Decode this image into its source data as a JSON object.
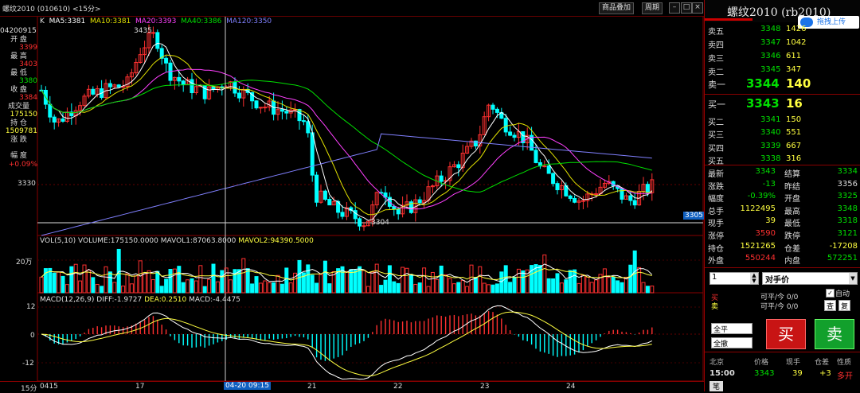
{
  "app": {
    "title": "螺纹2010 (010610) <15分>",
    "btn_add": "商品叠加",
    "btn_period": "周期"
  },
  "main_chart": {
    "indicator_label": "K",
    "ma5": "MA5:3381",
    "ma10": "MA10:3381",
    "ma20": "MA20:3393",
    "ma40": "MA40:3386",
    "ma120": "MA120:3350",
    "high_marker": "3435",
    "low_marker": "3304",
    "right_tag": "3305",
    "y_label": "3330",
    "info": {
      "date": "04200915",
      "open_label": "开 盘",
      "open": "3399",
      "high_label": "最 高",
      "high": "3403",
      "low_label": "最 低",
      "low": "3380",
      "close_label": "收 盘",
      "close": "3384",
      "vol_label": "成交量",
      "vol": "175150",
      "oi_label": "持 仓",
      "oi": "1509781",
      "chg_label": "涨 跌",
      "chg": "",
      "pct_label": "幅 度",
      "pct": "+0.09%"
    }
  },
  "vol_chart": {
    "label": "VOL(5,10)",
    "volume": "VOLUME:175150.0000",
    "mavol1": "MAVOL1:87063.8000",
    "mavol2": "MAVOL2:94390.5000",
    "y_label": "20万"
  },
  "macd_chart": {
    "label": "MACD(12,26,9)",
    "diff": "DIFF:-1.9727",
    "dea": "DEA:0.2510",
    "macd": "MACD:-4.4475",
    "y_top": "12",
    "y_mid": "0",
    "y_bot": "-12"
  },
  "xaxis": {
    "period": "15分",
    "labels": [
      "0415",
      "17",
      "21",
      "22",
      "23",
      "24"
    ],
    "cursor": "04-20 09:15"
  },
  "panel": {
    "title": "螺纹2010 (rb2010)",
    "cloud": "拖拽上传",
    "asks": [
      {
        "label": "卖五",
        "price": "3348",
        "vol": "1426"
      },
      {
        "label": "卖四",
        "price": "3347",
        "vol": "1042"
      },
      {
        "label": "卖三",
        "price": "3346",
        "vol": "611"
      },
      {
        "label": "卖二",
        "price": "3345",
        "vol": "347"
      },
      {
        "label": "卖一",
        "price": "3344",
        "vol": "140"
      }
    ],
    "bids": [
      {
        "label": "买一",
        "price": "3343",
        "vol": "16"
      },
      {
        "label": "买二",
        "price": "3341",
        "vol": "150"
      },
      {
        "label": "买三",
        "price": "3340",
        "vol": "551"
      },
      {
        "label": "买四",
        "price": "3339",
        "vol": "667"
      },
      {
        "label": "买五",
        "price": "3338",
        "vol": "316"
      }
    ],
    "stats": [
      {
        "l1": "最新",
        "v1": "3343",
        "c1": "g",
        "l2": "结算",
        "v2": "3334",
        "c2": "g"
      },
      {
        "l1": "涨跌",
        "v1": "-13",
        "c1": "g",
        "l2": "昨结",
        "v2": "3356",
        "c2": "w"
      },
      {
        "l1": "幅度",
        "v1": "-0.39%",
        "c1": "g",
        "l2": "开盘",
        "v2": "3325",
        "c2": "g"
      },
      {
        "l1": "总手",
        "v1": "1122495",
        "c1": "y",
        "l2": "最高",
        "v2": "3348",
        "c2": "g"
      },
      {
        "l1": "现手",
        "v1": "39",
        "c1": "y",
        "l2": "最低",
        "v2": "3318",
        "c2": "g"
      },
      {
        "l1": "涨停",
        "v1": "3590",
        "c1": "r",
        "l2": "跌停",
        "v2": "3121",
        "c2": "g"
      },
      {
        "l1": "持仓",
        "v1": "1521265",
        "c1": "y",
        "l2": "仓差",
        "v2": "-17208",
        "c2": "y"
      },
      {
        "l1": "外盘",
        "v1": "550244",
        "c1": "r",
        "l2": "内盘",
        "v2": "572251",
        "c2": "g"
      }
    ],
    "order": {
      "qty": "1",
      "price_type": "对手价",
      "buy_label": "买",
      "sell_label": "卖",
      "ping1": "可平/今 0/0",
      "ping2": "可平/今 0/0",
      "auto": "自动",
      "btn_cha": "查",
      "btn_fu": "复",
      "btn_quanping": "全平",
      "btn_quanche": "全撤",
      "btn_buy": "买",
      "btn_sell": "卖"
    },
    "tick_header": [
      "北京",
      "价格",
      "现手",
      "仓差",
      "性质"
    ],
    "tick": {
      "time": "15:00",
      "price": "3343",
      "vol": "39",
      "oi": "+3",
      "nature": "多开"
    },
    "bottom_tab": "笔"
  },
  "colors": {
    "up": "#ff3030",
    "down": "#00ffff",
    "ma5": "#ffffff",
    "ma10": "#e0e000",
    "ma20": "#ff40ff",
    "ma40": "#00e000",
    "ma120": "#8080ff"
  }
}
